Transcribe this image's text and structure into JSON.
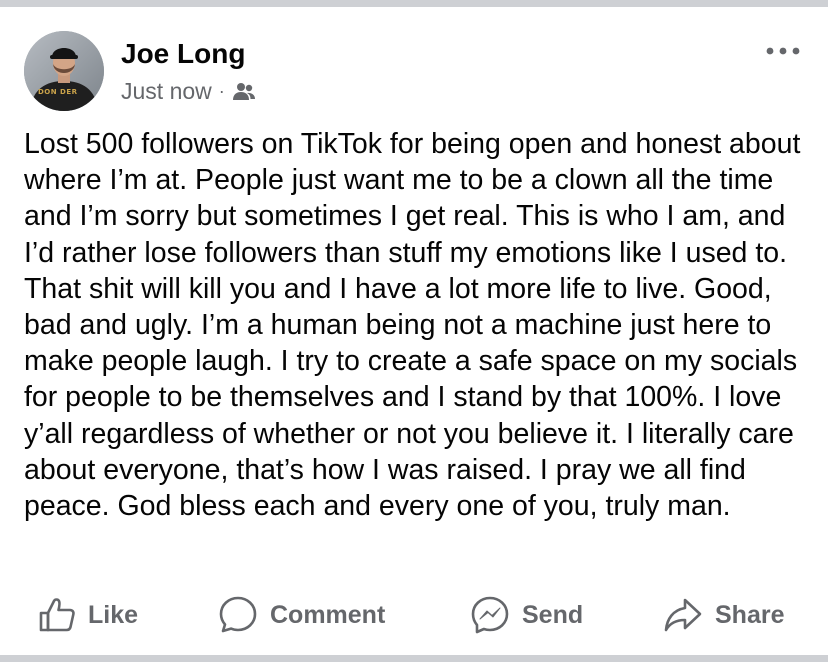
{
  "post": {
    "author": "Joe Long",
    "timestamp": "Just now",
    "separator": "·",
    "audience_icon": "friends-icon",
    "more_icon": "more-options-icon",
    "avatar_text": "DON DER",
    "text": "Lost 500 followers on TikTok for being open and honest about where I’m at. People just want me to be a clown all the time and I’m sorry but sometimes I get real. This is who I am, and I’d rather lose followers than stuff my emotions like I used to. That shit will kill you and I have a lot more life to live. Good, bad and ugly. I’m a human being not a machine just here to make people laugh. I try to create a safe space on my socials for people to be themselves and I stand by that 100%. I love y’all regardless of whether or not you believe it. I literally care about everyone, that’s how I was raised. I pray we all find peace. God bless each and every one of you, truly man."
  },
  "actions": {
    "like": "Like",
    "comment": "Comment",
    "send": "Send",
    "share": "Share"
  },
  "colors": {
    "text": "#050505",
    "secondary": "#65676b",
    "background": "#ffffff",
    "frame": "#ced0d4"
  }
}
